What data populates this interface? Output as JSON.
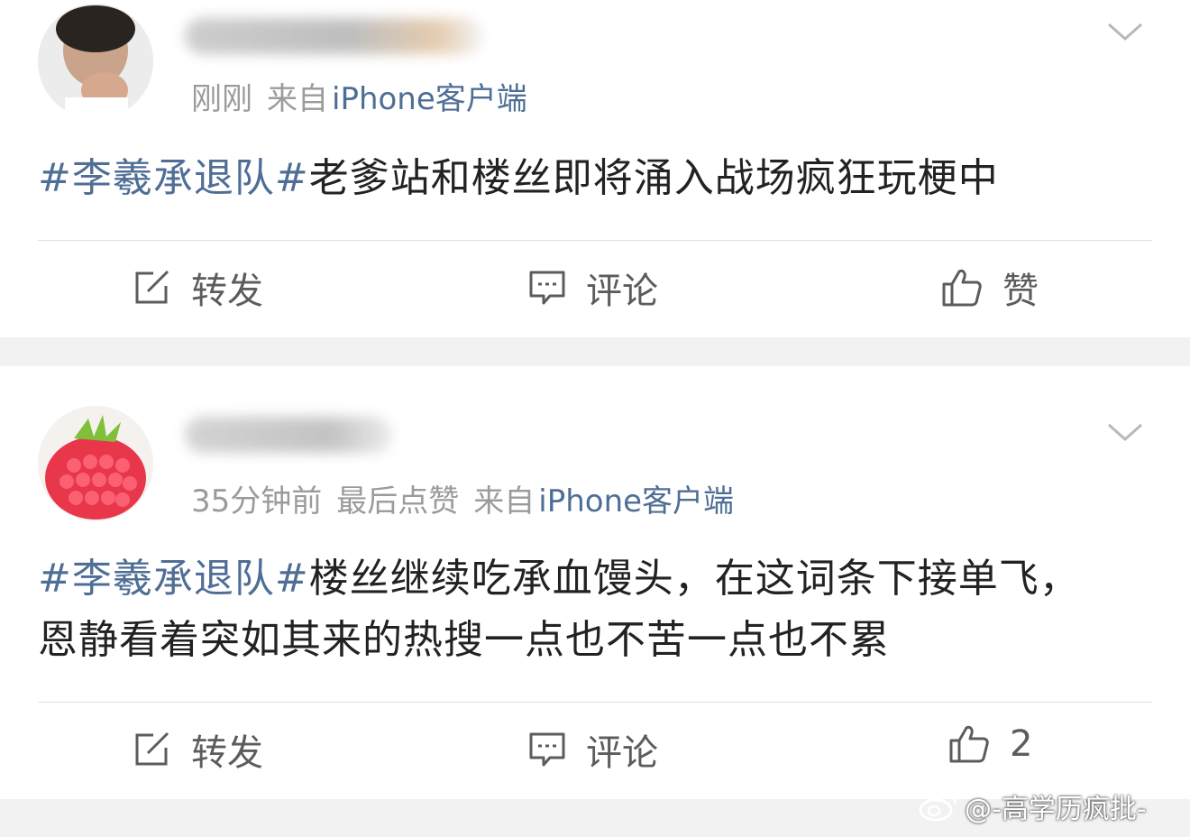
{
  "posts": [
    {
      "time": "刚刚",
      "source": "来自",
      "client": "iPhone客户端",
      "hashtag": "#李羲承退队#",
      "text": "老爹站和楼丝即将涌入战场疯狂玩梗中",
      "actions": {
        "repost": "转发",
        "comment": "评论",
        "like": "赞"
      }
    },
    {
      "time": "35分钟前",
      "extra": "最后点赞",
      "source": "来自",
      "client": "iPhone客户端",
      "hashtag": "#李羲承退队#",
      "text": "楼丝继续吃承血馒头，在这词条下接单飞，恩静看着突如其来的热搜一点也不苦一点也不累",
      "actions": {
        "repost": "转发",
        "comment": "评论",
        "like": "2"
      }
    }
  ],
  "icons": {
    "repost": "repost-icon",
    "comment": "comment-icon",
    "like": "thumbs-up-icon",
    "more": "chevron-down-icon",
    "weibo": "weibo-logo-icon"
  },
  "watermark": "@-高学历疯批-",
  "colors": {
    "link": "#4f6e96",
    "meta": "#9b9b9b",
    "text": "#222222",
    "background": "#f2f2f2"
  }
}
